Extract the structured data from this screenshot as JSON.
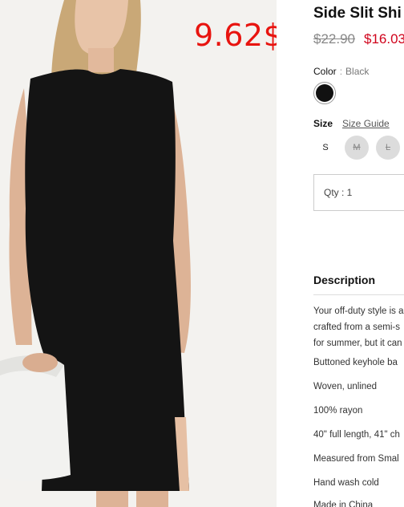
{
  "product": {
    "title": "Side Slit Shi",
    "old_price": "$22.90",
    "new_price": "$16.03"
  },
  "overlay_price": "9.62$",
  "color": {
    "label": "Color",
    "separator": ":",
    "value": "Black",
    "swatch_hex": "#111111"
  },
  "size": {
    "label": "Size",
    "guide_label": "Size Guide",
    "options": [
      {
        "label": "S",
        "available": true
      },
      {
        "label": "M",
        "available": false
      },
      {
        "label": "L",
        "available": false
      }
    ]
  },
  "qty": {
    "label": "Qty : 1"
  },
  "description": {
    "title": "Description",
    "lines": [
      "Your off-duty style is a",
      "crafted from a semi-s",
      "for summer, but it can"
    ],
    "features": [
      "Buttoned keyhole ba",
      "Woven, unlined",
      "100% rayon",
      "40\" full length, 41\" ch",
      "Measured from Smal",
      "Hand wash cold",
      "Made in China"
    ]
  },
  "colors": {
    "price_overlay": "#e8140f",
    "sale_price": "#d0021b"
  }
}
